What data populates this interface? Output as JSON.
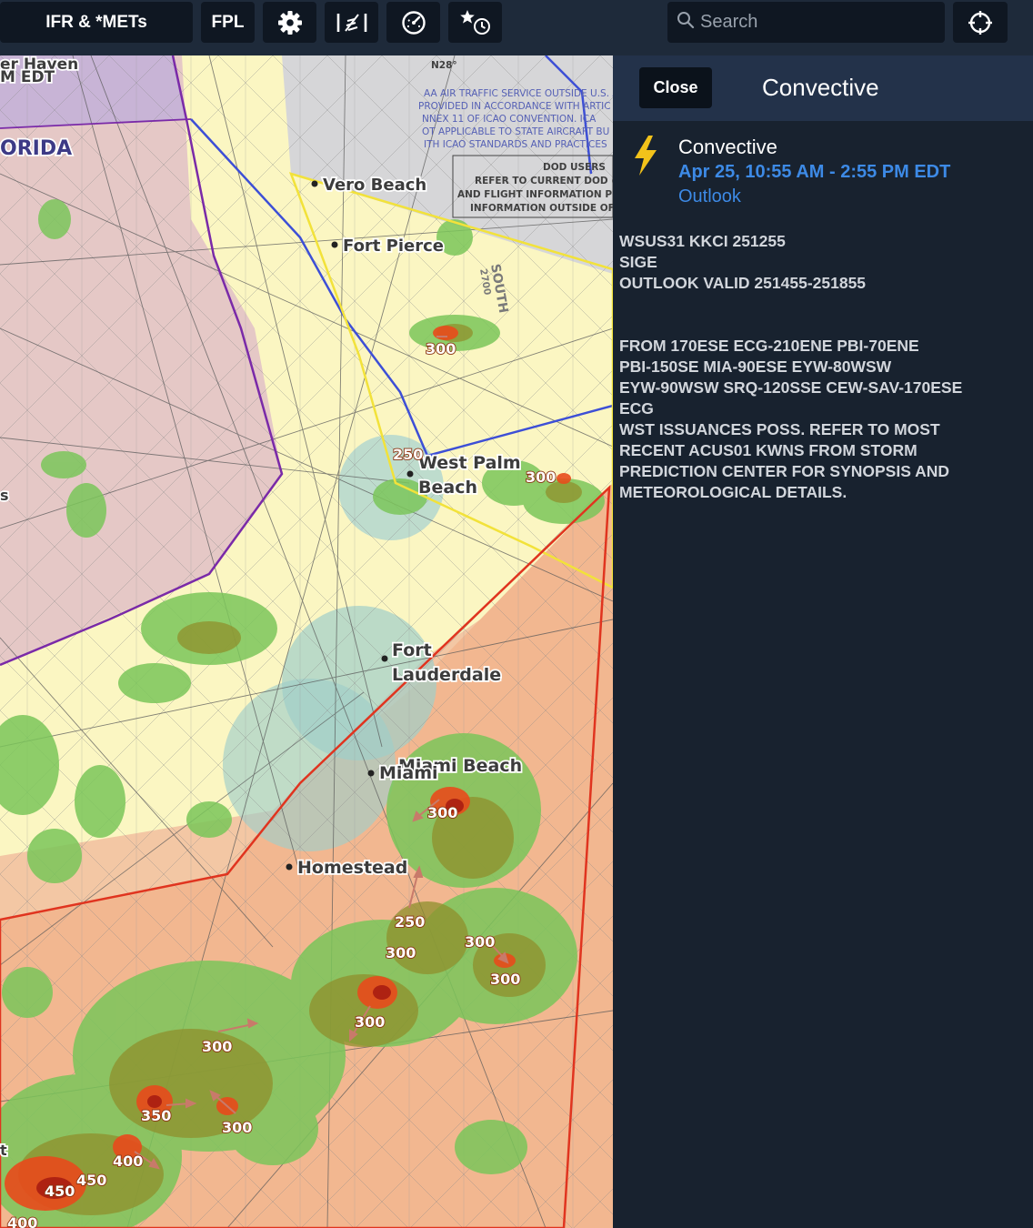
{
  "toolbar": {
    "layers_label": "IFR & *METs",
    "fpl_label": "FPL",
    "settings_icon": "gear-icon",
    "wind_icon": "wind-barbs-icon",
    "gauge_icon": "gauge-icon",
    "favorites_icon": "star-clock-icon",
    "search_placeholder": "Search",
    "locate_icon": "crosshair-icon"
  },
  "map": {
    "labels": {
      "haven": "er Haven",
      "edt": "M EDT",
      "florida": "ORIDA",
      "vero_beach": "Vero Beach",
      "fort_pierce": "Fort Pierce",
      "west_palm_1": "West Palm",
      "west_palm_2": "Beach",
      "fort_lauderdale_1": "Fort",
      "fort_lauderdale_2": "Lauderdale",
      "miami": "Miami",
      "miami_beach": "Miami Beach",
      "homestead": "Homestead",
      "n28": "N28°",
      "south": "SOUTH",
      "south_alt": "2700",
      "left_s": "s",
      "left_t": "t",
      "notice": [
        "AA AIR TRAFFIC SERVICE OUTSIDE U.S. A",
        "PROVIDED IN ACCORDANCE WITH ARTIC",
        "NNEX 11 OF ICAO CONVENTION. ICA",
        "OT APPLICABLE TO STATE AIRCRAFT BU",
        "ITH ICAO STANDARDS AND PRACTICES"
      ],
      "dod": [
        "DOD USERS",
        "REFER TO CURRENT DOD (NO",
        "AND FLIGHT INFORMATION PUBL",
        "INFORMATION OUTSIDE OF U"
      ]
    },
    "storm_tops": [
      "300",
      "250",
      "300",
      "300",
      "250",
      "300",
      "300",
      "300",
      "300",
      "300",
      "350",
      "300",
      "400",
      "450",
      "450",
      "400"
    ],
    "colors": {
      "advisory_red": "#e0341f",
      "outlook_yellow": "#f2e23a",
      "boundary_blue": "#3d4fd6",
      "boundary_purple": "#7a2aa8"
    }
  },
  "panel": {
    "close_label": "Close",
    "title": "Convective",
    "advisory": {
      "icon": "lightning-bolt-icon",
      "title": "Convective",
      "time": "Apr 25, 10:55 AM - 2:55 PM EDT",
      "kind": "Outlook",
      "lines": [
        "WSUS31 KKCI 251255",
        "SIGE",
        "OUTLOOK VALID 251455-251855",
        "",
        "",
        "FROM 170ESE ECG-210ENE PBI-70ENE",
        "PBI-150SE MIA-90ESE EYW-80WSW",
        "EYW-90WSW SRQ-120SSE CEW-SAV-170ESE",
        "ECG",
        "WST ISSUANCES POSS. REFER TO MOST",
        "RECENT ACUS01 KWNS FROM STORM",
        "PREDICTION CENTER FOR SYNOPSIS AND",
        "METEOROLOGICAL DETAILS."
      ]
    }
  }
}
